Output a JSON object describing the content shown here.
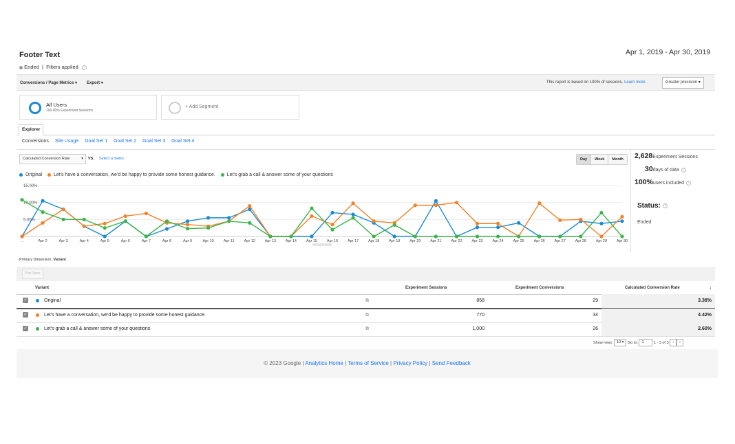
{
  "header": {
    "title": "Footer Text",
    "date_range": "Apr 1, 2019 - Apr 30, 2019",
    "status": "Ended",
    "filters": "Filters applied"
  },
  "toolbar": {
    "breadcrumb": "Conversions / Page Metrics",
    "export": "Export",
    "report_note": "This report is based on 100% of sessions.",
    "learn_more": "Learn more",
    "precision": "Greater precision"
  },
  "segments": {
    "all_users_title": "All Users",
    "all_users_sub": "100.00% Experiment Sessions",
    "add_segment": "+ Add Segment"
  },
  "tabs": {
    "explorer": "Explorer",
    "subtabs": [
      "Conversions",
      "Site Usage",
      "Goal Set 1",
      "Goal Set 2",
      "Goal Set 3",
      "Goal Set 4"
    ]
  },
  "metric": {
    "selected": "Calculated Conversion Rate",
    "vs": "VS.",
    "select_metric": "Select a metric"
  },
  "granularity": [
    "Day",
    "Week",
    "Month"
  ],
  "side": {
    "sessions_value": "2,628",
    "sessions_label": "Experiment Sessions",
    "days_value": "30",
    "days_label": "days of data",
    "users_value": "100%",
    "users_label": "users included",
    "status_label": "Status:",
    "status_value": "Ended"
  },
  "chart_data": {
    "type": "line",
    "ylim": [
      0,
      15
    ],
    "y_ticks": [
      "15.00%",
      "10.00%",
      "5.00%"
    ],
    "categories": [
      "...",
      "Apr 2",
      "Apr 3",
      "Apr 4",
      "Apr 5",
      "Apr 6",
      "Apr 7",
      "Apr 8",
      "Apr 9",
      "Apr 10",
      "Apr 11",
      "Apr 12",
      "Apr 13",
      "Apr 14",
      "Apr 15",
      "Apr 16",
      "Apr 17",
      "Apr 18",
      "Apr 19",
      "Apr 20",
      "Apr 21",
      "Apr 22",
      "Apr 23",
      "Apr 24",
      "Apr 25",
      "Apr 26",
      "Apr 27",
      "Apr 28",
      "Apr 29",
      "Apr 30"
    ],
    "series": [
      {
        "name": "Original",
        "color": "#1a8ad4",
        "values": [
          0,
          10.5,
          8,
          3,
          0,
          4.5,
          0,
          2.2,
          4.5,
          5.5,
          5.5,
          8,
          0,
          0,
          0,
          7,
          6.5,
          4,
          0,
          0,
          10.5,
          0,
          2.7,
          2.7,
          4,
          0,
          0,
          4.5,
          3.8,
          4.5
        ]
      },
      {
        "name": "Let's have a conversation, we'd be happy to provide some honest guidance.",
        "color": "#f28127",
        "values": [
          0,
          4,
          8,
          3,
          3.8,
          6,
          6.8,
          4,
          3.5,
          3,
          4.5,
          9,
          0,
          0,
          6,
          3.5,
          9.8,
          4.5,
          4,
          9.2,
          9.2,
          10,
          3.8,
          3.8,
          0,
          9.8,
          4.8,
          5,
          0,
          5.8
        ]
      },
      {
        "name": "Let's grab a call & answer some of your questions",
        "color": "#3bb44a",
        "values": [
          10.8,
          7.2,
          5,
          5,
          2.5,
          4.5,
          0,
          4.5,
          2.3,
          2.5,
          4.5,
          4,
          0,
          0,
          8.3,
          2,
          5.5,
          0,
          3.4,
          0,
          0,
          0,
          0,
          0,
          0,
          0,
          0,
          0,
          7,
          0
        ]
      }
    ]
  },
  "table": {
    "primary_dimension_label": "Primary Dimension:",
    "primary_dimension_value": "Variant",
    "plot_rows": "Plot Rows",
    "columns": [
      "Variant",
      "Experiment Sessions",
      "Experiment Conversions",
      "Calculated Conversion Rate"
    ],
    "rows": [
      {
        "variant": "Original",
        "color": "#1a8ad4",
        "sessions": "858",
        "conversions": "29",
        "rate": "3.38%"
      },
      {
        "variant": "Let's have a conversation, we'd be happy to provide some honest guidance.",
        "color": "#f28127",
        "sessions": "770",
        "conversions": "34",
        "rate": "4.42%"
      },
      {
        "variant": "Let's grab a call & answer some of your questions",
        "color": "#3bb44a",
        "sessions": "1,000",
        "conversions": "26",
        "rate": "2.60%"
      }
    ],
    "show_rows_label": "Show rows:",
    "show_rows_value": "10",
    "goto_label": "Go to:",
    "goto_value": "1",
    "range": "1 - 3 of 3"
  },
  "footer": {
    "copyright": "© 2023 Google |",
    "links": [
      "Analytics Home",
      "Terms of Service",
      "Privacy Policy",
      "Send Feedback"
    ]
  }
}
